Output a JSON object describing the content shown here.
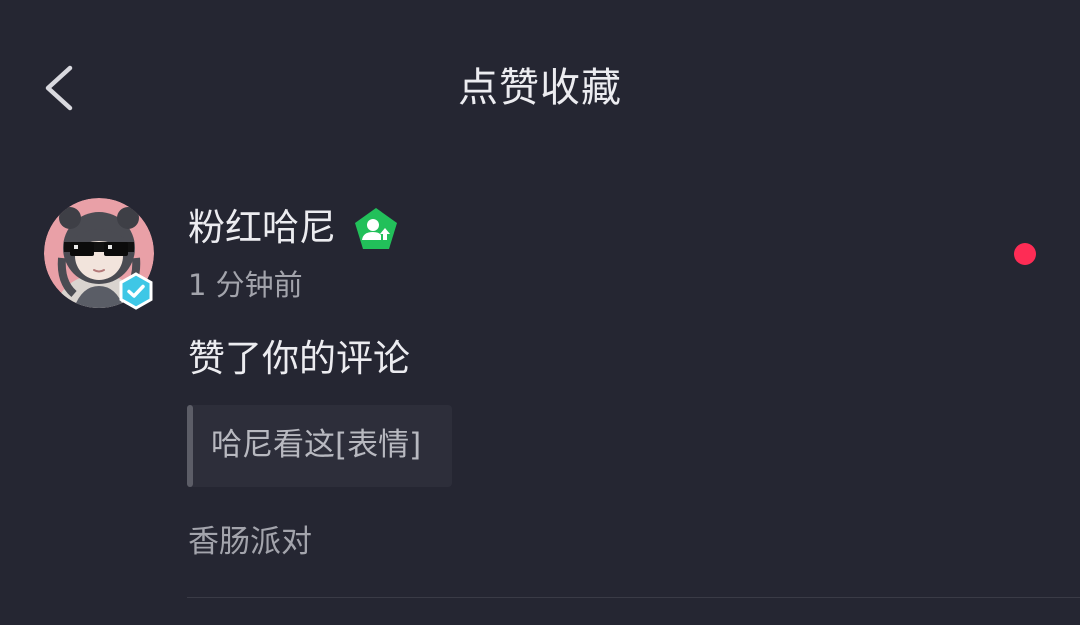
{
  "header": {
    "title": "点赞收藏",
    "back_icon": "chevron-left-icon"
  },
  "notification": {
    "username": "粉红哈尼",
    "time": "1 分钟前",
    "action": "赞了你的评论",
    "quoted_comment": "哈尼看这[表情]",
    "source": "香肠派对",
    "unread": true,
    "avatar_icon": "user-avatar",
    "verified_icon": "verified-check-icon",
    "level_icon": "user-level-up-icon"
  },
  "colors": {
    "background": "#252632",
    "unread_dot": "#fe2c55",
    "level_badge": "#22c05a",
    "verified_badge": "#3ec7e6"
  }
}
